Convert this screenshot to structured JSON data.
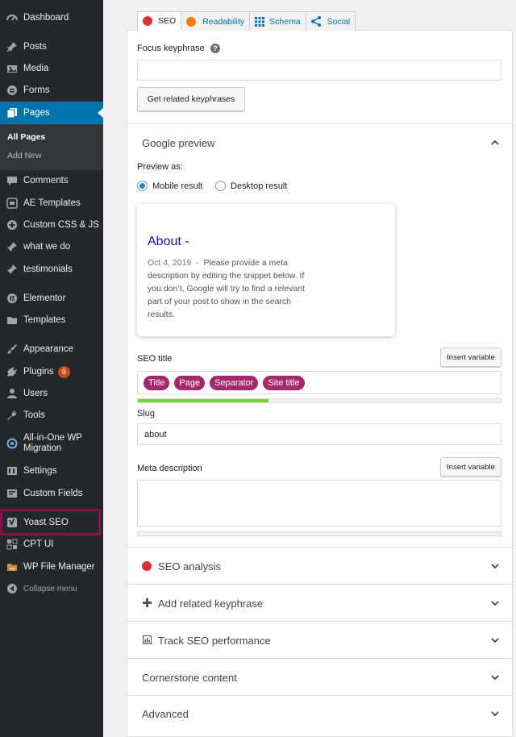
{
  "sidebar": {
    "items": [
      {
        "label": "Dashboard",
        "icon": "dashboard-icon"
      },
      {
        "label": "Posts",
        "icon": "pin-icon"
      },
      {
        "label": "Media",
        "icon": "media-icon"
      },
      {
        "label": "Forms",
        "icon": "forms-icon"
      },
      {
        "label": "Pages",
        "icon": "pages-icon",
        "active": true
      },
      {
        "label": "Comments",
        "icon": "comment-icon"
      },
      {
        "label": "AE Templates",
        "icon": "ae-icon"
      },
      {
        "label": "Custom CSS & JS",
        "icon": "plus-circle-icon"
      },
      {
        "label": "what we do",
        "icon": "pin-icon"
      },
      {
        "label": "testimonials",
        "icon": "pin-icon"
      },
      {
        "label": "Elementor",
        "icon": "elementor-icon"
      },
      {
        "label": "Templates",
        "icon": "folder-icon"
      },
      {
        "label": "Appearance",
        "icon": "brush-icon"
      },
      {
        "label": "Plugins",
        "icon": "plug-icon",
        "badge": "9"
      },
      {
        "label": "Users",
        "icon": "user-icon"
      },
      {
        "label": "Tools",
        "icon": "wrench-icon"
      },
      {
        "label": "All-in-One WP Migration",
        "icon": "migration-icon"
      },
      {
        "label": "Settings",
        "icon": "settings-icon"
      },
      {
        "label": "Custom Fields",
        "icon": "fields-icon"
      },
      {
        "label": "Yoast SEO",
        "icon": "yoast-icon"
      },
      {
        "label": "CPT UI",
        "icon": "grid-icon"
      },
      {
        "label": "WP File Manager",
        "icon": "file-manager-icon"
      },
      {
        "label": "Collapse menu",
        "icon": "collapse-icon"
      }
    ],
    "submenu": {
      "all_pages": "All Pages",
      "add_new": "Add New"
    }
  },
  "tabs": {
    "seo": "SEO",
    "readability": "Readability",
    "schema": "Schema",
    "social": "Social"
  },
  "focus": {
    "label": "Focus keyphrase",
    "help": "?",
    "value": "",
    "button": "Get related keyphrases"
  },
  "google_preview": {
    "title": "Google preview",
    "preview_as": "Preview as:",
    "mobile": "Mobile result",
    "desktop": "Desktop result",
    "selected": "Mobile result",
    "card_title": "About -",
    "card_date": "Oct 4, 2019",
    "card_sep": "-",
    "card_desc": "Please provide a meta description by editing the snippet below. If you don’t, Google will try to find a relevant part of your post to show in the search results."
  },
  "seo_title": {
    "label": "SEO title",
    "insert": "Insert variable",
    "pills": [
      "Title",
      "Page",
      "Separator",
      "Site title"
    ],
    "progress": 0.36
  },
  "slug": {
    "label": "Slug",
    "value": "about"
  },
  "meta": {
    "label": "Meta description",
    "insert": "Insert variable",
    "value": ""
  },
  "sections": {
    "seo_analysis": "SEO analysis",
    "related": "Add related keyphrase",
    "track": "Track SEO performance",
    "cornerstone": "Cornerstone content",
    "advanced": "Advanced"
  },
  "colors": {
    "accent": "#0073aa",
    "pill": "#a4286a",
    "error": "#dc3232",
    "progress": "#7ad03a",
    "yoast_highlight": "#8d1045"
  }
}
